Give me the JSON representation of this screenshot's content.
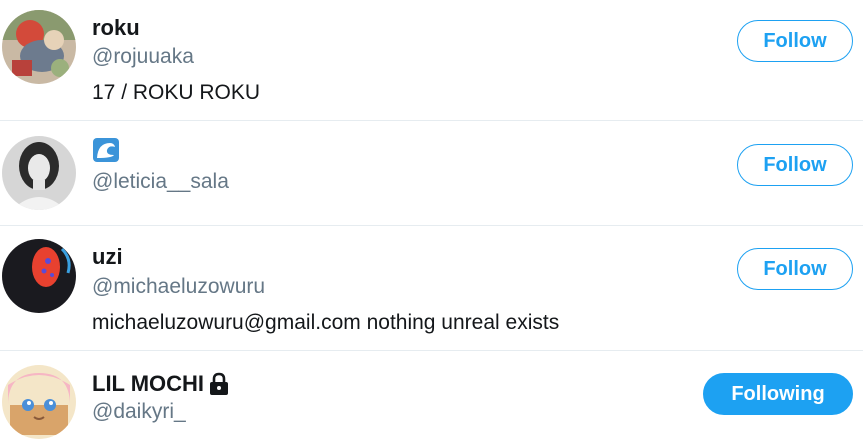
{
  "users": [
    {
      "name": "roku",
      "handle": "@rojuuaka",
      "bio": "17 / ROKU ROKU",
      "button": "Follow",
      "avatar": "colorful-photo-avatar"
    },
    {
      "name": "",
      "name_icon": "water-wave-emoji-icon",
      "handle": "@leticia__sala",
      "bio": "",
      "button": "Follow",
      "avatar": "grayscale-portrait-avatar"
    },
    {
      "name": "uzi",
      "handle": "@michaeluzowuru",
      "bio": "michaeluzowuru@gmail.com nothing unreal exists",
      "button": "Follow",
      "avatar": "dark-abstract-red-avatar"
    },
    {
      "name": "LIL MOCHI",
      "name_icon": "lock-icon",
      "handle": "@daikyri_",
      "bio": "",
      "button": "Following",
      "avatar": "anime-character-avatar"
    }
  ],
  "colors": {
    "accent": "#1da1f2",
    "handle_gray": "#657786",
    "text": "#14171a",
    "divider": "#e6ecf0"
  }
}
